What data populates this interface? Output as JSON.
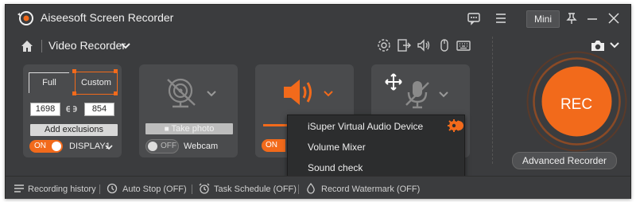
{
  "app": {
    "title": "Aiseesoft Screen Recorder",
    "mini_label": "Mini"
  },
  "toolbar": {
    "mode_title": "Video Recorder"
  },
  "display": {
    "full_label": "Full",
    "custom_label": "Custom",
    "width": "1698",
    "height": "854",
    "add_exclusions_label": "Add exclusions",
    "toggle_label": "ON",
    "display_name": "DISPLAY1"
  },
  "webcam": {
    "take_photo_label": "Take photo",
    "toggle_label": "OFF",
    "label": "Webcam"
  },
  "system_sound": {
    "toggle_label": "ON"
  },
  "audio_menu": {
    "items": [
      "iSuper Virtual Audio Device",
      "Volume Mixer",
      "Sound check"
    ]
  },
  "rec": {
    "label": "REC",
    "advanced_label": "Advanced Recorder"
  },
  "status": {
    "recording_history": "Recording history",
    "auto_stop": "Auto Stop (OFF)",
    "task_schedule": "Task Schedule (OFF)",
    "record_watermark": "Record Watermark (OFF)"
  },
  "colors": {
    "accent": "#f26a1b",
    "window": "#3b3c3e",
    "card": "#4a4b4d"
  }
}
